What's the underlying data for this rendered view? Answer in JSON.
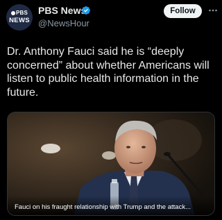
{
  "account": {
    "display_name": "PBS News",
    "handle": "@NewsHour",
    "verified": true,
    "avatar_logo_line1": "PBS",
    "avatar_logo_line2": "NEWS"
  },
  "actions": {
    "follow_label": "Follow",
    "more_icon": "ellipsis-icon"
  },
  "post": {
    "text": "Dr. Anthony Fauci said he is “deeply concerned” about whether Americans will listen to public health information in the future."
  },
  "link_card": {
    "caption": "Fauci on his fraught relationship with Trump and the attack..."
  },
  "colors": {
    "background": "#000000",
    "text_primary": "#e7e9ea",
    "text_secondary": "#8b98a5",
    "verified_badge": "#1d9bf0",
    "follow_button_bg": "#eff3f4"
  }
}
